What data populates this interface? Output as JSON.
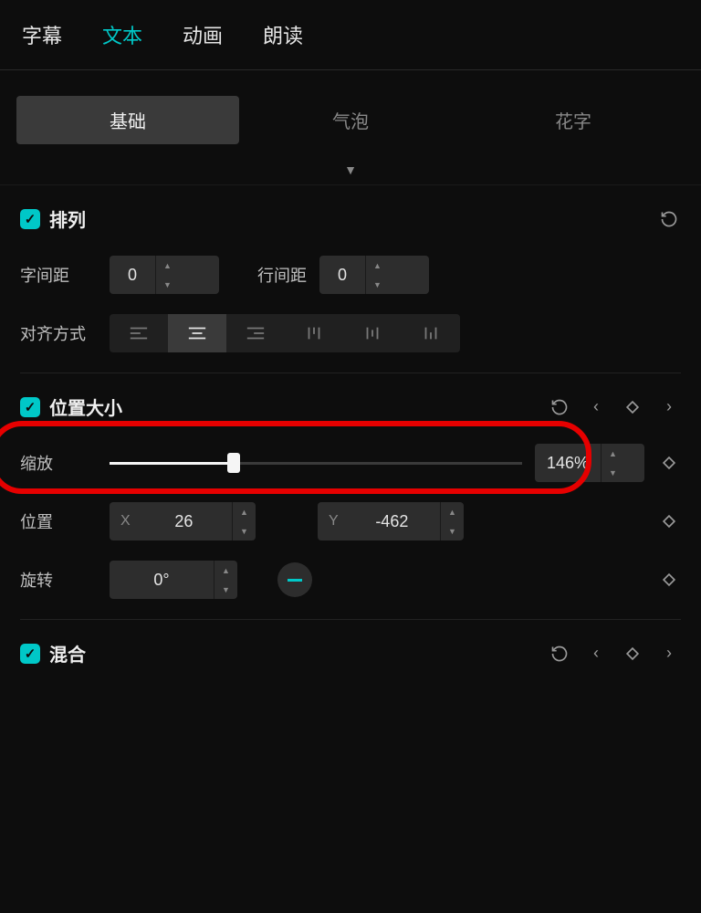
{
  "top_tabs": {
    "subtitle": "字幕",
    "text": "文本",
    "animation": "动画",
    "read": "朗读"
  },
  "sub_tabs": {
    "basic": "基础",
    "bubble": "气泡",
    "fancy": "花字"
  },
  "arrange": {
    "title": "排列",
    "char_spacing_label": "字间距",
    "char_spacing_value": "0",
    "line_spacing_label": "行间距",
    "line_spacing_value": "0",
    "align_label": "对齐方式"
  },
  "position_size": {
    "title": "位置大小",
    "scale_label": "缩放",
    "scale_value": "146%",
    "scale_percent": 30,
    "position_label": "位置",
    "pos_x_prefix": "X",
    "pos_x_value": "26",
    "pos_y_prefix": "Y",
    "pos_y_value": "-462",
    "rotation_label": "旋转",
    "rotation_value": "0°"
  },
  "blend": {
    "title": "混合"
  }
}
